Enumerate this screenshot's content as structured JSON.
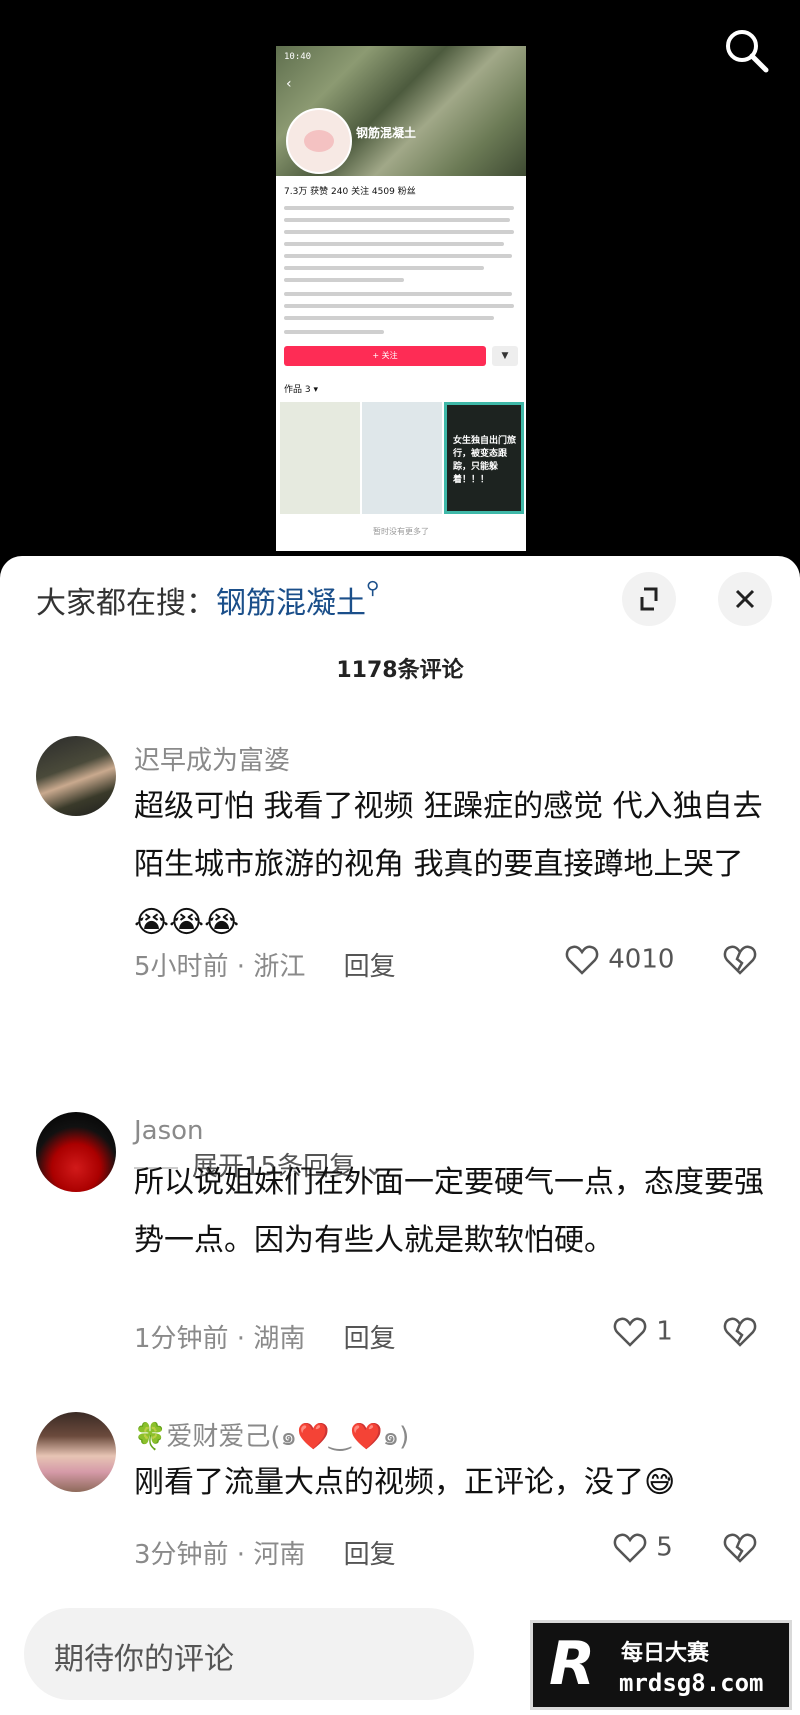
{
  "preview": {
    "status_time": "10:40",
    "profile_name": "钢筋混凝土",
    "stats": "7.3万 获赞   240 关注   4509 粉丝",
    "follow_label": "+ 关注",
    "works_label": "作品 3 ▾",
    "thumb3_text": "女生独自出门旅行，被变态跟踪，只能躲着！！！",
    "footer": "暂时没有更多了"
  },
  "hot_search": {
    "prefix": "大家都在搜：",
    "term": "钢筋混凝土",
    "icon": "search-small-icon"
  },
  "comment_count": "1178条评论",
  "comments": [
    {
      "user": "迟早成为富婆",
      "text": "超级可怕 我看了视频 狂躁症的感觉 代入独自去陌生城市旅游的视角 我真的要直接蹲地上哭了😭😭😭",
      "time_location": "5小时前 · 浙江",
      "reply_label": "回复",
      "likes": "4010",
      "expand_label": "展开15条回复"
    },
    {
      "user": "Jason",
      "text": "所以说姐妹们在外面一定要硬气一点，态度要强势一点。因为有些人就是欺软怕硬。",
      "time_location": "1分钟前 · 湖南",
      "reply_label": "回复",
      "likes": "1"
    },
    {
      "user": "🍀爱财爱己(๑❤️‿❤️๑)",
      "text": "刚看了流量大点的视频，正评论，没了😅",
      "time_location": "3分钟前 · 河南",
      "reply_label": "回复",
      "likes": "5"
    }
  ],
  "input_placeholder": "期待你的评论",
  "watermark": {
    "title": "每日大赛",
    "url": "mrdsg8.com"
  },
  "colors": {
    "accent_red": "#fe2c55",
    "hot_term_blue": "#1b4f8a"
  }
}
